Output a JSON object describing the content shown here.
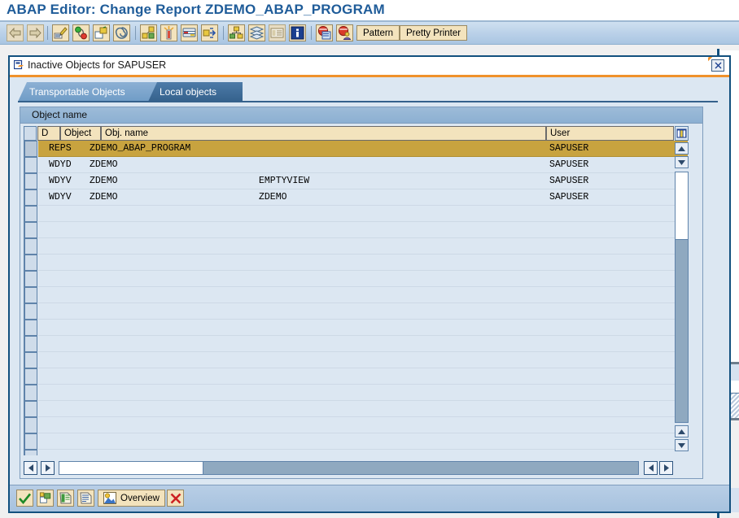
{
  "window": {
    "title": "ABAP Editor: Change Report ZDEMO_ABAP_PROGRAM"
  },
  "toolbar": {
    "buttons": [
      {
        "name": "back-button",
        "icon": "arrow-left-icon",
        "label": "",
        "enabled": false
      },
      {
        "name": "forward-button",
        "icon": "arrow-right-icon",
        "label": "",
        "enabled": false
      },
      {
        "name": "display-change-button",
        "icon": "pencil-icon",
        "label": "",
        "enabled": true
      },
      {
        "name": "check-syntax-button",
        "icon": "traffic-lights-icon",
        "label": "",
        "enabled": true
      },
      {
        "name": "activate-button",
        "icon": "objects-icon",
        "label": "",
        "enabled": true
      },
      {
        "name": "generate-button",
        "icon": "spiral-icon",
        "label": "",
        "enabled": true
      },
      {
        "name": "where-used-list-button",
        "icon": "network-nodes-icon",
        "label": "",
        "enabled": true
      },
      {
        "name": "insert-statement-button",
        "icon": "column-light-icon",
        "label": "",
        "enabled": true
      },
      {
        "name": "display-object-list-button",
        "icon": "navigation-stack-icon",
        "label": "",
        "enabled": true
      },
      {
        "name": "other-object-button",
        "icon": "arrows-object-icon",
        "label": "",
        "enabled": true
      },
      {
        "name": "object-hierarchy-button",
        "icon": "hierarchy-icon",
        "label": "",
        "enabled": true
      },
      {
        "name": "stack-button",
        "icon": "stack-icon",
        "label": "",
        "enabled": true
      },
      {
        "name": "list-button",
        "icon": "list-icon",
        "label": "",
        "enabled": false
      },
      {
        "name": "information-button",
        "icon": "info-icon",
        "label": "",
        "enabled": true
      },
      {
        "name": "debugging-button",
        "icon": "debug-screen-icon",
        "label": "",
        "enabled": true
      },
      {
        "name": "debugging-user-button",
        "icon": "debug-user-icon",
        "label": "",
        "enabled": true
      },
      {
        "name": "pattern-button",
        "icon": "",
        "label": "Pattern",
        "enabled": true
      },
      {
        "name": "pretty-printer-button",
        "icon": "",
        "label": "Pretty Printer",
        "enabled": true
      }
    ]
  },
  "dialog": {
    "title": "Inactive Objects for SAPUSER",
    "close_label": "×",
    "tabs": [
      {
        "name": "tab-transportable-objects",
        "label": "Transportable Objects",
        "active": false
      },
      {
        "name": "tab-local-objects",
        "label": "Local objects",
        "active": true
      }
    ],
    "panel": {
      "header": "Object name",
      "columns": [
        {
          "key": "d",
          "label": "D"
        },
        {
          "key": "object",
          "label": "Object"
        },
        {
          "key": "obj_name",
          "label": "Obj. name"
        },
        {
          "key": "user",
          "label": "User"
        }
      ],
      "rows": [
        {
          "d": "",
          "object": "REPS",
          "obj_name": "ZDEMO_ABAP_PROGRAM",
          "obj_name2": "",
          "user": "SAPUSER",
          "selected": true
        },
        {
          "d": "",
          "object": "WDYD",
          "obj_name": "ZDEMO",
          "obj_name2": "",
          "user": "SAPUSER",
          "selected": false
        },
        {
          "d": "",
          "object": "WDYV",
          "obj_name": "ZDEMO",
          "obj_name2": "EMPTYVIEW",
          "user": "SAPUSER",
          "selected": false
        },
        {
          "d": "",
          "object": "WDYV",
          "obj_name": "ZDEMO",
          "obj_name2": "ZDEMO",
          "user": "SAPUSER",
          "selected": false
        }
      ],
      "empty_row_count": 18
    },
    "buttons": [
      {
        "name": "continue-button",
        "icon": "green-check-icon",
        "label": ""
      },
      {
        "name": "activate-objects-button",
        "icon": "objects-icon",
        "label": ""
      },
      {
        "name": "display-log-button",
        "icon": "green-doc-icon",
        "label": ""
      },
      {
        "name": "display-document-button",
        "icon": "blue-doc-icon",
        "label": ""
      },
      {
        "name": "overview-button",
        "icon": "overview-icon",
        "label": "Overview"
      },
      {
        "name": "cancel-button",
        "icon": "red-x-icon",
        "label": ""
      }
    ]
  },
  "colors": {
    "title_blue": "#1f5c99",
    "dialog_border": "#12507e",
    "accent_orange": "#f0922b",
    "selected_row": "#c8a33f",
    "grid_bg": "#dce7f2",
    "header_tan": "#f3e3bd"
  }
}
